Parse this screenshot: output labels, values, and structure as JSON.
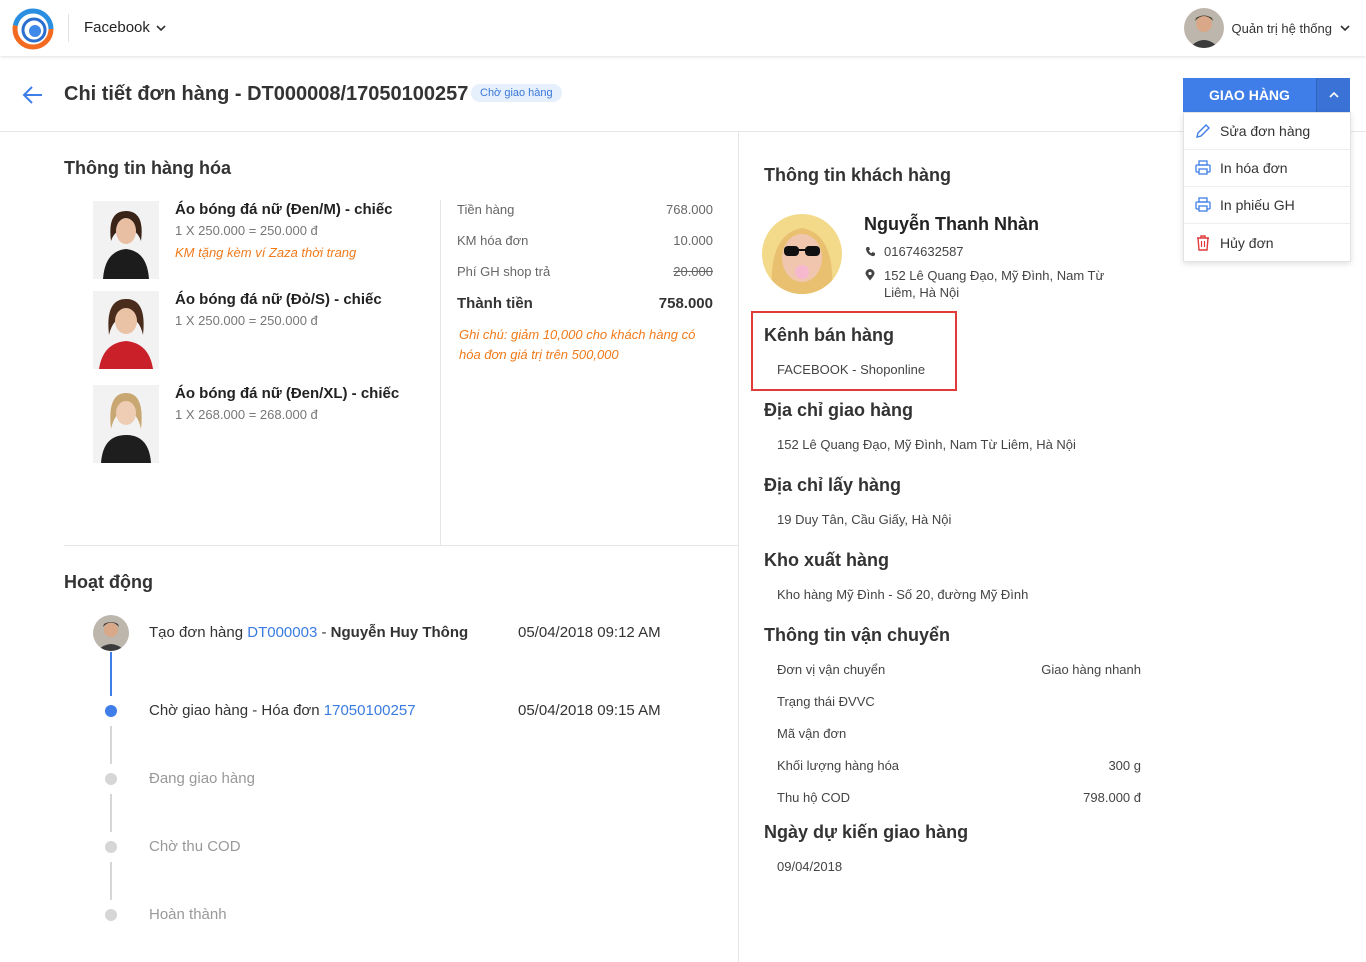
{
  "topbar": {
    "channel": "Facebook",
    "user": "Quản trị hệ thống"
  },
  "header": {
    "title": "Chi tiết đơn hàng - DT000008/17050100257",
    "status": "Chờ giao hàng"
  },
  "actions": {
    "ship_label": "GIAO HÀNG",
    "menu": [
      {
        "label": "Sửa đơn hàng",
        "icon": "pencil-icon"
      },
      {
        "label": "In hóa đơn",
        "icon": "printer-icon"
      },
      {
        "label": "In phiếu GH",
        "icon": "printer-icon"
      },
      {
        "label": "Hủy đơn",
        "icon": "trash-icon"
      }
    ]
  },
  "goods": {
    "title": "Thông tin hàng hóa",
    "products": [
      {
        "name": "Áo bóng đá nữ (Đen/M) - chiếc",
        "qty": "1 X 250.000 = 250.000 đ",
        "promo": "KM tặng kèm ví Zaza thời trang"
      },
      {
        "name": "Áo bóng đá nữ (Đỏ/S) - chiếc",
        "qty": "1 X 250.000 = 250.000 đ",
        "promo": ""
      },
      {
        "name": "Áo bóng đá nữ (Đen/XL) - chiếc",
        "qty": "1 X 268.000 = 268.000 đ",
        "promo": ""
      }
    ],
    "summary": {
      "subtotal_label": "Tiền hàng",
      "subtotal": "768.000",
      "discount_label": "KM hóa đơn",
      "discount": "10.000",
      "shipfee_label": "Phí GH shop trả",
      "shipfee": "20.000",
      "total_label": "Thành tiền",
      "total": "758.000",
      "note": "Ghi chú: giảm 10,000 cho khách hàng có hóa đơn giá trị trên 500,000"
    }
  },
  "activity": {
    "title": "Hoạt động",
    "steps": [
      {
        "prefix": "Tạo đơn hàng ",
        "link": "DT000003",
        "sep": " - ",
        "actor": "Nguyễn Huy Thông",
        "time": "05/04/2018 09:12 AM"
      },
      {
        "prefix": "Chờ giao hàng",
        "sep": " - Hóa đơn ",
        "link": "17050100257",
        "time": "05/04/2018 09:15 AM"
      },
      {
        "label": "Đang giao hàng"
      },
      {
        "label": "Chờ thu COD"
      },
      {
        "label": "Hoàn thành"
      }
    ]
  },
  "customer": {
    "title": "Thông tin khách hàng",
    "name": "Nguyễn Thanh Nhàn",
    "phone": "01674632587",
    "address_line1": "152 Lê Quang Đạo, Mỹ Đình, Nam Từ",
    "address_line2": "Liêm, Hà Nội"
  },
  "sales_channel": {
    "title": "Kênh bán hàng",
    "value": "FACEBOOK -  Shoponline"
  },
  "delivery_address": {
    "title": "Địa chỉ giao hàng",
    "value": "152 Lê Quang Đạo, Mỹ Đình, Nam Từ Liêm, Hà Nội"
  },
  "pickup_address": {
    "title": "Địa chỉ lấy hàng",
    "value": "19 Duy Tân, Cầu Giấy, Hà Nội"
  },
  "warehouse": {
    "title": "Kho xuất hàng",
    "value": "Kho hàng Mỹ Đình - Số 20, đường Mỹ Đình"
  },
  "shipping": {
    "title": "Thông tin vận chuyển",
    "rows": [
      {
        "label": "Đơn vị vận chuyển",
        "value": "Giao hàng nhanh"
      },
      {
        "label": "Trạng thái ĐVVC",
        "value": ""
      },
      {
        "label": "Mã vận đơn",
        "value": ""
      },
      {
        "label": "Khối lượng hàng hóa",
        "value": "300 g"
      },
      {
        "label": "Thu hộ COD",
        "value": "798.000 đ"
      }
    ]
  },
  "expected_date": {
    "title": "Ngày dự kiến giao hàng",
    "value": "09/04/2018"
  },
  "colors": {
    "accent": "#3f7ee8",
    "promo": "#f07a1a",
    "highlight": "#e03a3a"
  }
}
